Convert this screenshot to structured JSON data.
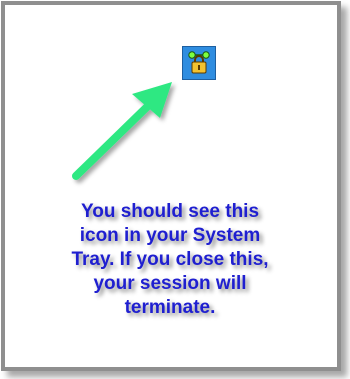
{
  "panel": {
    "icon": "system-tray-network-lock-icon",
    "arrow_color": "#2ee882",
    "text_color": "#1f1fd0",
    "message": "You should see this\nicon in your System\nTray.  If you close this,\nyour session will\nterminate."
  }
}
